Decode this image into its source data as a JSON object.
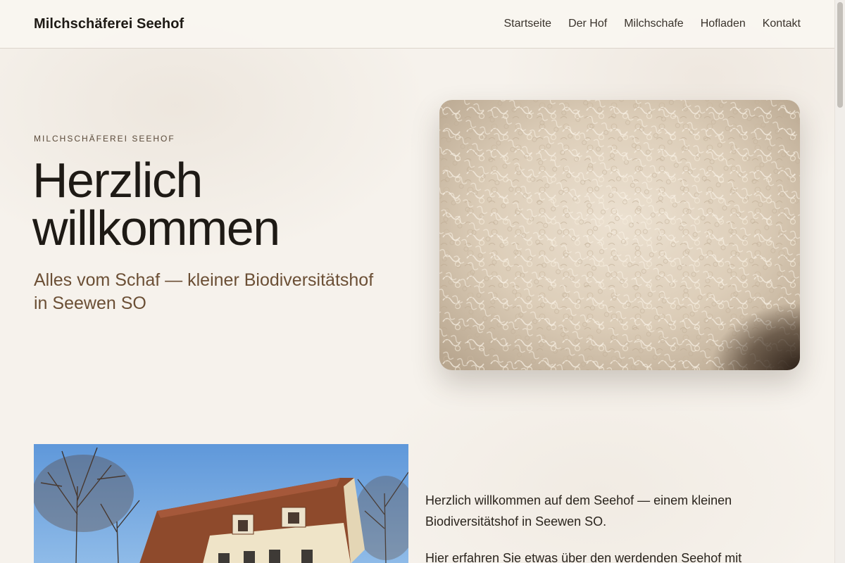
{
  "header": {
    "brand": "Milchschäferei Seehof",
    "nav": [
      "Startseite",
      "Der Hof",
      "Milchschafe",
      "Hofladen",
      "Kontakt"
    ]
  },
  "hero": {
    "eyebrow": "MILCHSCHÄFEREI SEEHOF",
    "title_line1": "Herzlich",
    "title_line2": "willkommen",
    "subtitle": "Alles vom Schaf — kleiner Biodiversitätshof in Seewen SO"
  },
  "intro": {
    "p1": "Herzlich willkommen auf dem Seehof — einem kleinen Biodiversitätshof in Seewen SO.",
    "p2": "Hier erfahren Sie etwas über den werdenden Seehof mit viel"
  },
  "colors": {
    "background": "#f6f2ec",
    "accent_brown": "#6b4f35",
    "text": "#1e1a15"
  }
}
